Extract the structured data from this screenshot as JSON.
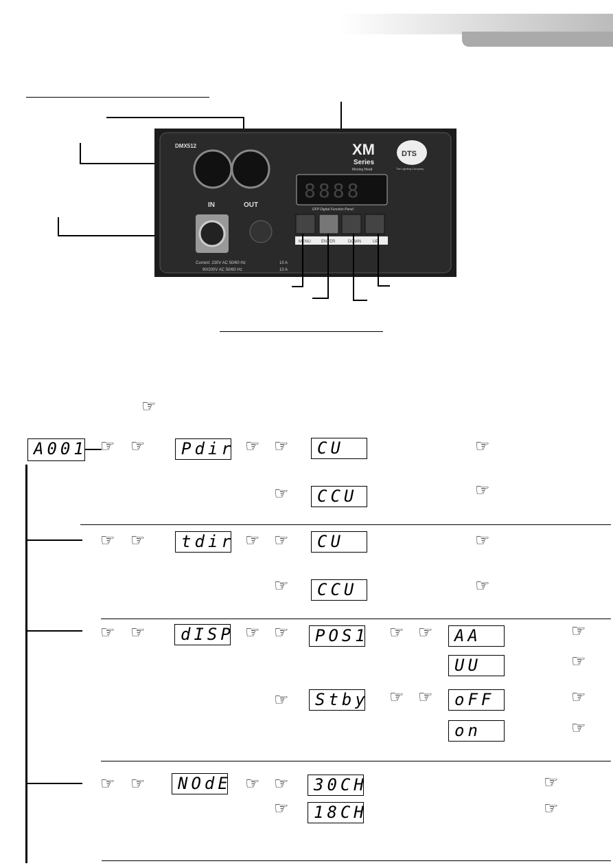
{
  "header": {
    "accent": "#aaaaaa"
  },
  "photo_labels": {
    "connector": "DMX512",
    "in": "IN",
    "out": "OUT",
    "brand": "XM",
    "series": "Series",
    "product": "Moving Head",
    "logo": "DTS",
    "tagline": "The Lighting Company",
    "panel": "DFP Digital Function Panel",
    "display": "8888",
    "buttons": [
      "MENU",
      "ENTER",
      "DOWN",
      "UP"
    ],
    "power1": "Current: 230V AC 50/60 Hz",
    "power2": "90/200V AC 50/60 Hz",
    "fuse1": "10 A",
    "fuse2": "10 A"
  },
  "hand_icon": "☞",
  "menu": {
    "root": "A001",
    "rows": [
      {
        "name": "Pdir",
        "options": [
          "CU",
          "CCU"
        ]
      },
      {
        "name": "tdir",
        "options": [
          "CU",
          "CCU"
        ]
      },
      {
        "name": "dISP",
        "options": [
          "POS1",
          "Stby"
        ],
        "sub": {
          "POS1": [
            "AA",
            "UU"
          ],
          "Stby": [
            "oFF",
            "on"
          ]
        }
      },
      {
        "name": "NOdE",
        "options": [
          "30CH",
          "18CH"
        ]
      }
    ]
  }
}
